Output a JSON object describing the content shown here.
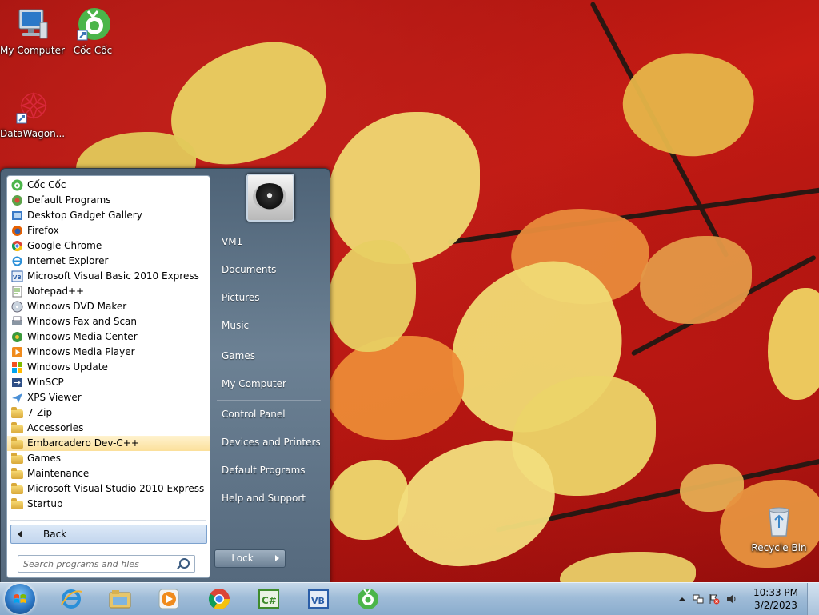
{
  "desktop": {
    "icons": [
      {
        "label": "My Computer"
      },
      {
        "label": "Cốc Cốc"
      },
      {
        "label": "DataWagon..."
      },
      {
        "label": "Recycle Bin"
      }
    ]
  },
  "start_menu": {
    "programs": [
      {
        "label": "Cốc Cốc",
        "icon": "coccoc-icon"
      },
      {
        "label": "Default Programs",
        "icon": "default-programs-icon"
      },
      {
        "label": "Desktop Gadget Gallery",
        "icon": "gadget-gallery-icon"
      },
      {
        "label": "Firefox",
        "icon": "firefox-icon"
      },
      {
        "label": "Google Chrome",
        "icon": "chrome-icon"
      },
      {
        "label": "Internet Explorer",
        "icon": "internet-explorer-icon"
      },
      {
        "label": "Microsoft Visual Basic 2010 Express",
        "icon": "visual-basic-icon"
      },
      {
        "label": "Notepad++",
        "icon": "notepad-plus-plus-icon"
      },
      {
        "label": "Windows DVD Maker",
        "icon": "dvd-maker-icon"
      },
      {
        "label": "Windows Fax and Scan",
        "icon": "fax-scan-icon"
      },
      {
        "label": "Windows Media Center",
        "icon": "media-center-icon"
      },
      {
        "label": "Windows Media Player",
        "icon": "media-player-icon"
      },
      {
        "label": "Windows Update",
        "icon": "windows-update-icon"
      },
      {
        "label": "WinSCP",
        "icon": "winscp-icon"
      },
      {
        "label": "XPS Viewer",
        "icon": "xps-viewer-icon"
      },
      {
        "label": "7-Zip",
        "icon": "folder-icon"
      },
      {
        "label": "Accessories",
        "icon": "folder-icon"
      },
      {
        "label": "Embarcadero Dev-C++",
        "icon": "folder-icon",
        "highlighted": true
      },
      {
        "label": "Games",
        "icon": "folder-icon"
      },
      {
        "label": "Maintenance",
        "icon": "folder-icon"
      },
      {
        "label": "Microsoft Visual Studio 2010 Express",
        "icon": "folder-icon"
      },
      {
        "label": "Startup",
        "icon": "folder-icon"
      }
    ],
    "back_label": "Back",
    "search_placeholder": "Search programs and files",
    "right_items": [
      {
        "label": "VM1"
      },
      {
        "label": "Documents"
      },
      {
        "label": "Pictures"
      },
      {
        "label": "Music"
      },
      {
        "label": "Games"
      },
      {
        "label": "My Computer"
      },
      {
        "label": "Control Panel"
      },
      {
        "label": "Devices and Printers"
      },
      {
        "label": "Default Programs"
      },
      {
        "label": "Help and Support"
      }
    ],
    "lock_label": "Lock"
  },
  "taskbar": {
    "pinned": [
      "internet-explorer-icon",
      "explorer-folder-icon",
      "media-player-icon",
      "chrome-icon",
      "visual-csharp-icon",
      "visual-basic-icon",
      "coccoc-icon"
    ],
    "clock_time": "10:33 PM",
    "clock_date": "3/2/2023"
  }
}
